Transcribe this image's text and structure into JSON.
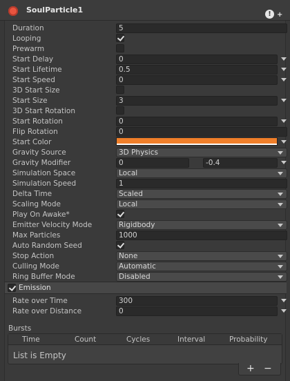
{
  "header": {
    "title": "SoulParticle1"
  },
  "rows": {
    "duration": {
      "label": "Duration",
      "value": "5"
    },
    "looping": {
      "label": "Looping"
    },
    "prewarm": {
      "label": "Prewarm"
    },
    "start_delay": {
      "label": "Start Delay",
      "value": "0"
    },
    "start_lifetime": {
      "label": "Start Lifetime",
      "value": "0.5"
    },
    "start_speed": {
      "label": "Start Speed",
      "value": "0"
    },
    "start_size_3d": {
      "label": "3D Start Size"
    },
    "start_size": {
      "label": "Start Size",
      "value": "3"
    },
    "start_rotation_3d": {
      "label": "3D Start Rotation"
    },
    "start_rotation": {
      "label": "Start Rotation",
      "value": "0"
    },
    "flip_rotation": {
      "label": "Flip Rotation",
      "value": "0"
    },
    "start_color": {
      "label": "Start Color",
      "color": "#f07f2a"
    },
    "gravity_source": {
      "label": "Gravity Source",
      "value": "3D Physics"
    },
    "gravity_modifier": {
      "label": "Gravity Modifier",
      "min": "0",
      "max": "-0.4"
    },
    "simulation_space": {
      "label": "Simulation Space",
      "value": "Local"
    },
    "simulation_speed": {
      "label": "Simulation Speed",
      "value": "1"
    },
    "delta_time": {
      "label": "Delta Time",
      "value": "Scaled"
    },
    "scaling_mode": {
      "label": "Scaling Mode",
      "value": "Local"
    },
    "play_on_awake": {
      "label": "Play On Awake*"
    },
    "emitter_velocity_mode": {
      "label": "Emitter Velocity Mode",
      "value": "Rigidbody"
    },
    "max_particles": {
      "label": "Max Particles",
      "value": "1000"
    },
    "auto_random_seed": {
      "label": "Auto Random Seed"
    },
    "stop_action": {
      "label": "Stop Action",
      "value": "None"
    },
    "culling_mode": {
      "label": "Culling Mode",
      "value": "Automatic"
    },
    "ring_buffer_mode": {
      "label": "Ring Buffer Mode",
      "value": "Disabled"
    }
  },
  "emission": {
    "title": "Emission",
    "rate_over_time": {
      "label": "Rate over Time",
      "value": "300"
    },
    "rate_over_distance": {
      "label": "Rate over Distance",
      "value": "0"
    },
    "bursts": {
      "label": "Bursts",
      "columns": [
        "Time",
        "Count",
        "Cycles",
        "Interval",
        "Probability"
      ],
      "empty_text": "List is Empty",
      "add": "+",
      "remove": "−"
    }
  }
}
